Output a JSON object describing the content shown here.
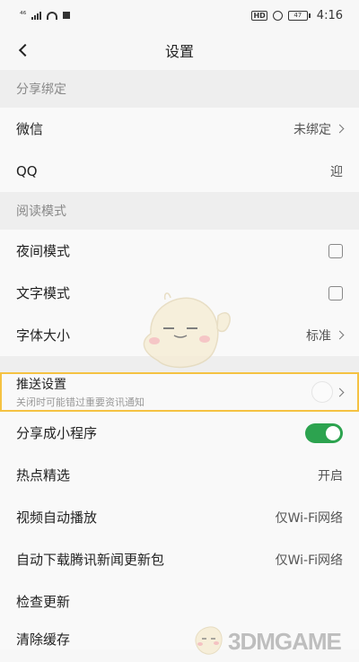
{
  "status_bar": {
    "network": "⁴⁶",
    "hd_badge": "HD",
    "battery": "47",
    "time": "4:16"
  },
  "nav": {
    "title": "设置"
  },
  "sections": {
    "share_binding": "分享绑定",
    "reading_mode": "阅读模式"
  },
  "rows": {
    "wechat": {
      "label": "微信",
      "value": "未绑定"
    },
    "qq": {
      "label": "QQ",
      "value": "迎"
    },
    "night_mode": {
      "label": "夜间模式",
      "checked": false
    },
    "text_mode": {
      "label": "文字模式",
      "checked": false
    },
    "font_size": {
      "label": "字体大小",
      "value": "标准"
    },
    "push": {
      "label": "推送设置",
      "sublabel": "关闭时可能错过重要资讯通知"
    },
    "mini_program": {
      "label": "分享成小程序",
      "enabled": true
    },
    "hot_pick": {
      "label": "热点精选",
      "value": "开启"
    },
    "autoplay": {
      "label": "视频自动播放",
      "value": "仅Wi-Fi网络"
    },
    "auto_download": {
      "label": "自动下载腾讯新闻更新包",
      "value": "仅Wi-Fi网络"
    },
    "check_update": {
      "label": "检查更新"
    },
    "clear_cache": {
      "label": "清除缓存"
    }
  },
  "watermark": {
    "text": "3DMGAME"
  },
  "colors": {
    "toggle_on": "#2ca34f",
    "highlight_border": "#f5c242"
  }
}
